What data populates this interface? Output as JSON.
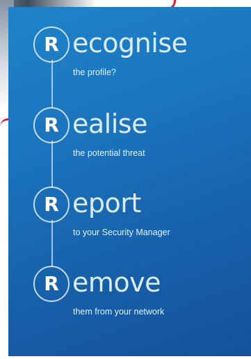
{
  "steps": [
    {
      "letter": "R",
      "rest": "ecognise",
      "subtitle": "the profile?"
    },
    {
      "letter": "R",
      "rest": "ealise",
      "subtitle": "the potential threat"
    },
    {
      "letter": "R",
      "rest": "eport",
      "subtitle": "to your Security Manager"
    },
    {
      "letter": "R",
      "rest": "emove",
      "subtitle": "them from your network"
    }
  ],
  "colors": {
    "panel_blue": "#1b74bd",
    "text_light": "#d8ecfb",
    "accent_red": "#d6202b"
  }
}
